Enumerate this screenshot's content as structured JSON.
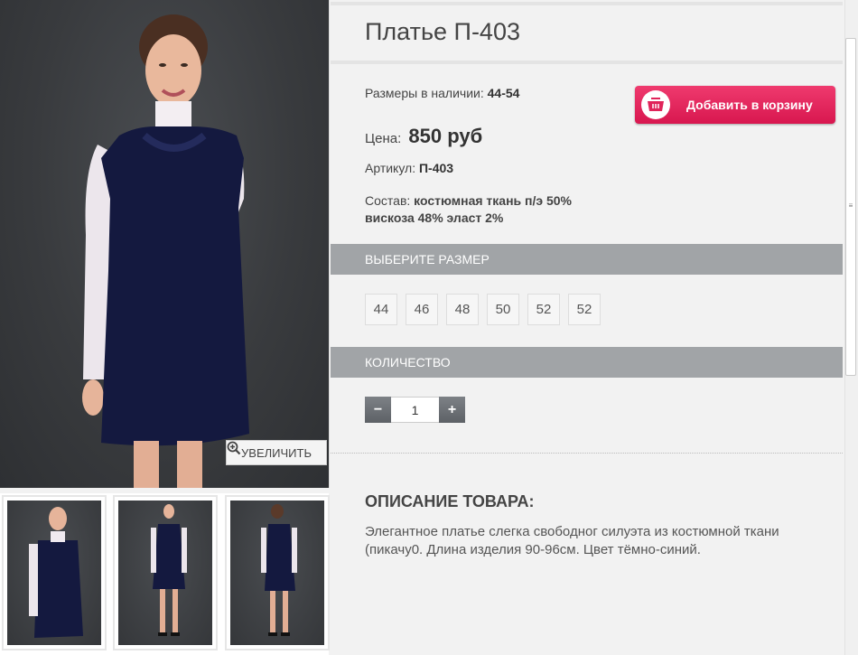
{
  "product": {
    "title": "Платье П-403",
    "sizes_label": "Размеры в наличии:",
    "sizes_value": "44-54",
    "price_label": "Цена:",
    "price_value": "850 руб",
    "sku_label": "Артикул:",
    "sku_value": "П-403",
    "composition_label": "Состав:",
    "composition_line1": "костюмная ткань п/э 50%",
    "composition_line2": "вискоза 48% эласт 2%"
  },
  "cart": {
    "label": "Добавить в корзину",
    "icon": "basket-icon",
    "color": "#e0245a"
  },
  "gallery": {
    "zoom_label": "УВЕЛИЧИТЬ",
    "zoom_icon": "magnifier-plus-icon"
  },
  "size_section": {
    "heading": "ВЫБЕРИТЕ РАЗМЕР",
    "options": [
      "44",
      "46",
      "48",
      "50",
      "52",
      "52"
    ]
  },
  "quantity_section": {
    "heading": "КОЛИЧЕСТВО",
    "minus": "−",
    "value": "1",
    "plus": "+"
  },
  "description": {
    "heading": "ОПИСАНИЕ ТОВАРА:",
    "text": "Элегантное платье слегка свободног силуэта из костюмной ткани (пикачу0. Длина изделия 90-96см. Цвет тёмно-синий."
  }
}
